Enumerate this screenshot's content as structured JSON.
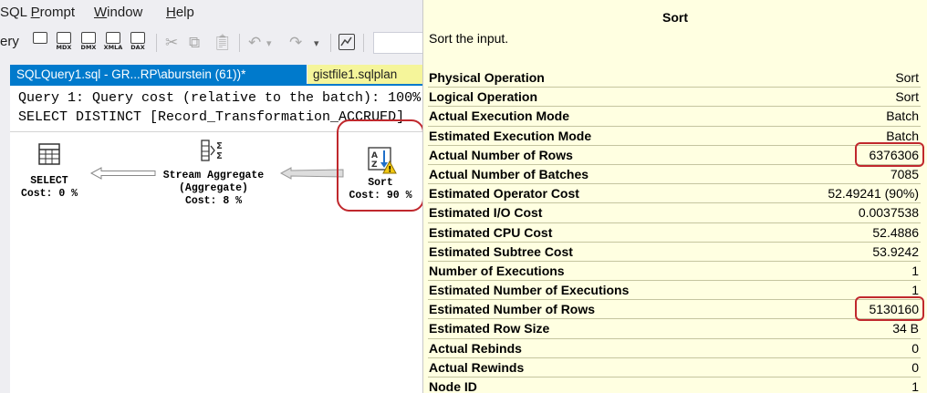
{
  "menu": {
    "items": [
      {
        "label": "SQL Prompt",
        "accel": "P"
      },
      {
        "label": "Window",
        "accel": "W"
      },
      {
        "label": "Help",
        "accel": "H"
      }
    ]
  },
  "toolbar": {
    "partial_label": "ery",
    "icons": [
      {
        "name": "new-query-icon",
        "caption": ""
      },
      {
        "name": "mdx-query-icon",
        "caption": "MDX"
      },
      {
        "name": "dmx-query-icon",
        "caption": "DMX"
      },
      {
        "name": "xmla-query-icon",
        "caption": "XMLA"
      },
      {
        "name": "dax-query-icon",
        "caption": "DAX"
      }
    ]
  },
  "tabs": {
    "active": "SQLQuery1.sql - GR...RP\\aburstein (61))*",
    "second": "gistfile1.sqlplan"
  },
  "editor": {
    "query_line1": "Query 1: Query cost (relative to the batch): 100%",
    "query_line2": "SELECT DISTINCT [Record_Transformation_ACCRUED]"
  },
  "plan_nodes": {
    "select": {
      "label": "SELECT",
      "cost": "Cost: 0 %"
    },
    "stream_aggregate": {
      "label": "Stream Aggregate",
      "sub": "(Aggregate)",
      "cost": "Cost: 8 %"
    },
    "sort": {
      "label": "Sort",
      "cost": "Cost: 90 %"
    }
  },
  "tooltip": {
    "title": "Sort",
    "description": "Sort the input.",
    "rows": [
      {
        "label": "Physical Operation",
        "value": "Sort"
      },
      {
        "label": "Logical Operation",
        "value": "Sort"
      },
      {
        "label": "Actual Execution Mode",
        "value": "Batch"
      },
      {
        "label": "Estimated Execution Mode",
        "value": "Batch"
      },
      {
        "label": "Actual Number of Rows",
        "value": "6376306",
        "highlight": true
      },
      {
        "label": "Actual Number of Batches",
        "value": "7085"
      },
      {
        "label": "Estimated Operator Cost",
        "value": "52.49241 (90%)"
      },
      {
        "label": "Estimated I/O Cost",
        "value": "0.0037538"
      },
      {
        "label": "Estimated CPU Cost",
        "value": "52.4886"
      },
      {
        "label": "Estimated Subtree Cost",
        "value": "53.9242"
      },
      {
        "label": "Number of Executions",
        "value": "1"
      },
      {
        "label": "Estimated Number of Executions",
        "value": "1"
      },
      {
        "label": "Estimated Number of Rows",
        "value": "5130160",
        "highlight": true
      },
      {
        "label": "Estimated Row Size",
        "value": "34 B"
      },
      {
        "label": "Actual Rebinds",
        "value": "0"
      },
      {
        "label": "Actual Rewinds",
        "value": "0"
      },
      {
        "label": "Node ID",
        "value": "1"
      }
    ]
  },
  "colors": {
    "tab_active": "#007acc",
    "tab_plan": "#f5f59a",
    "tooltip_bg": "#ffffe1",
    "highlight": "#c0282d",
    "warning": "#f2c811"
  }
}
